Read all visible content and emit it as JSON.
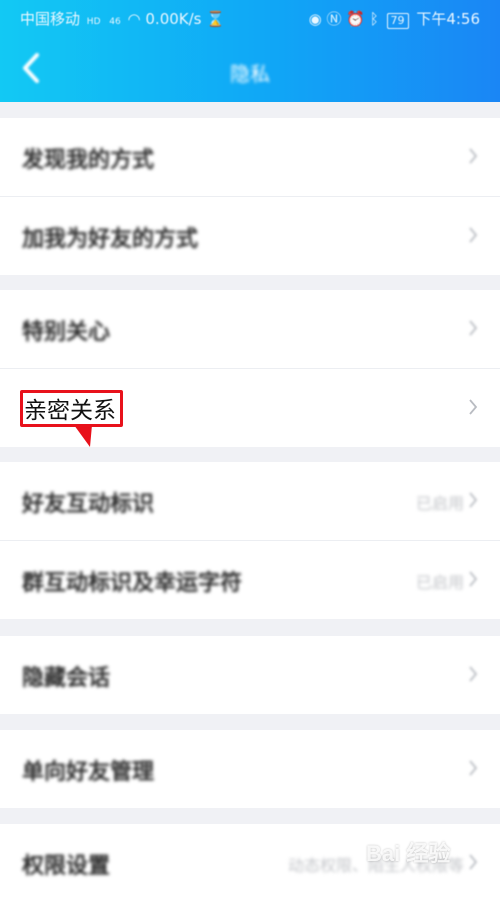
{
  "status_bar": {
    "carrier": "中国移动",
    "network": "HD",
    "signal": "46",
    "speed": "0.00K/s",
    "battery": "79",
    "time": "下午4:56"
  },
  "header": {
    "title": "隐私"
  },
  "sections": [
    {
      "rows": [
        {
          "label": "发现我的方式",
          "value": ""
        },
        {
          "label": "加我为好友的方式",
          "value": ""
        }
      ]
    },
    {
      "rows": [
        {
          "label": "特别关心",
          "value": ""
        },
        {
          "label": "亲密关系",
          "value": ""
        }
      ]
    },
    {
      "rows": [
        {
          "label": "好友互动标识",
          "value": "已启用"
        },
        {
          "label": "群互动标识及幸运字符",
          "value": "已启用"
        }
      ]
    },
    {
      "rows": [
        {
          "label": "隐藏会话",
          "value": ""
        }
      ]
    },
    {
      "rows": [
        {
          "label": "单向好友管理",
          "value": ""
        }
      ]
    },
    {
      "rows": [
        {
          "label": "权限设置",
          "value": "动态权限、陌生人权限等"
        }
      ]
    }
  ],
  "watermark": "Bai 经验",
  "colors": {
    "header_gradient_start": "#12c9f4",
    "header_gradient_end": "#1a86f5",
    "highlight_border": "#e8111b",
    "background": "#f0f1f5"
  }
}
